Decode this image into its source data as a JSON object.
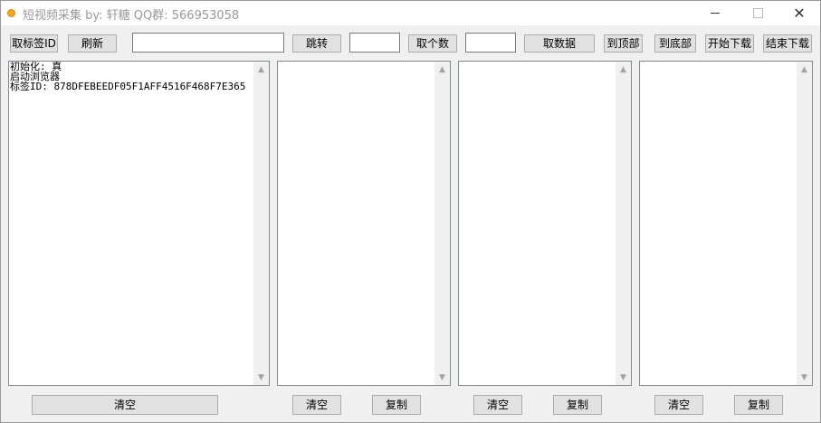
{
  "window": {
    "title": "短视频采集      by: 轩糖     QQ群: 566953058"
  },
  "toolbar": {
    "get_tag_id": "取标签ID",
    "refresh": "刷新",
    "url_value": "",
    "jump": "跳转",
    "count_value": "",
    "get_count": "取个数",
    "data_value": "",
    "get_data": "取数据",
    "to_top": "到顶部",
    "to_bottom": "到底部",
    "start_download": "开始下载",
    "stop_download": "结束下载"
  },
  "panels": [
    {
      "text": "初始化: 真\n启动浏览器\n标签ID: 878DFEBEEDF05F1AFF4516F468F7E365"
    },
    {
      "text": ""
    },
    {
      "text": ""
    },
    {
      "text": ""
    }
  ],
  "bottom": {
    "clear": "清空",
    "copy": "复制"
  },
  "icons": {
    "app": "app-icon",
    "minimize": "minimize-icon",
    "maximize": "maximize-icon",
    "close": "close-icon"
  }
}
